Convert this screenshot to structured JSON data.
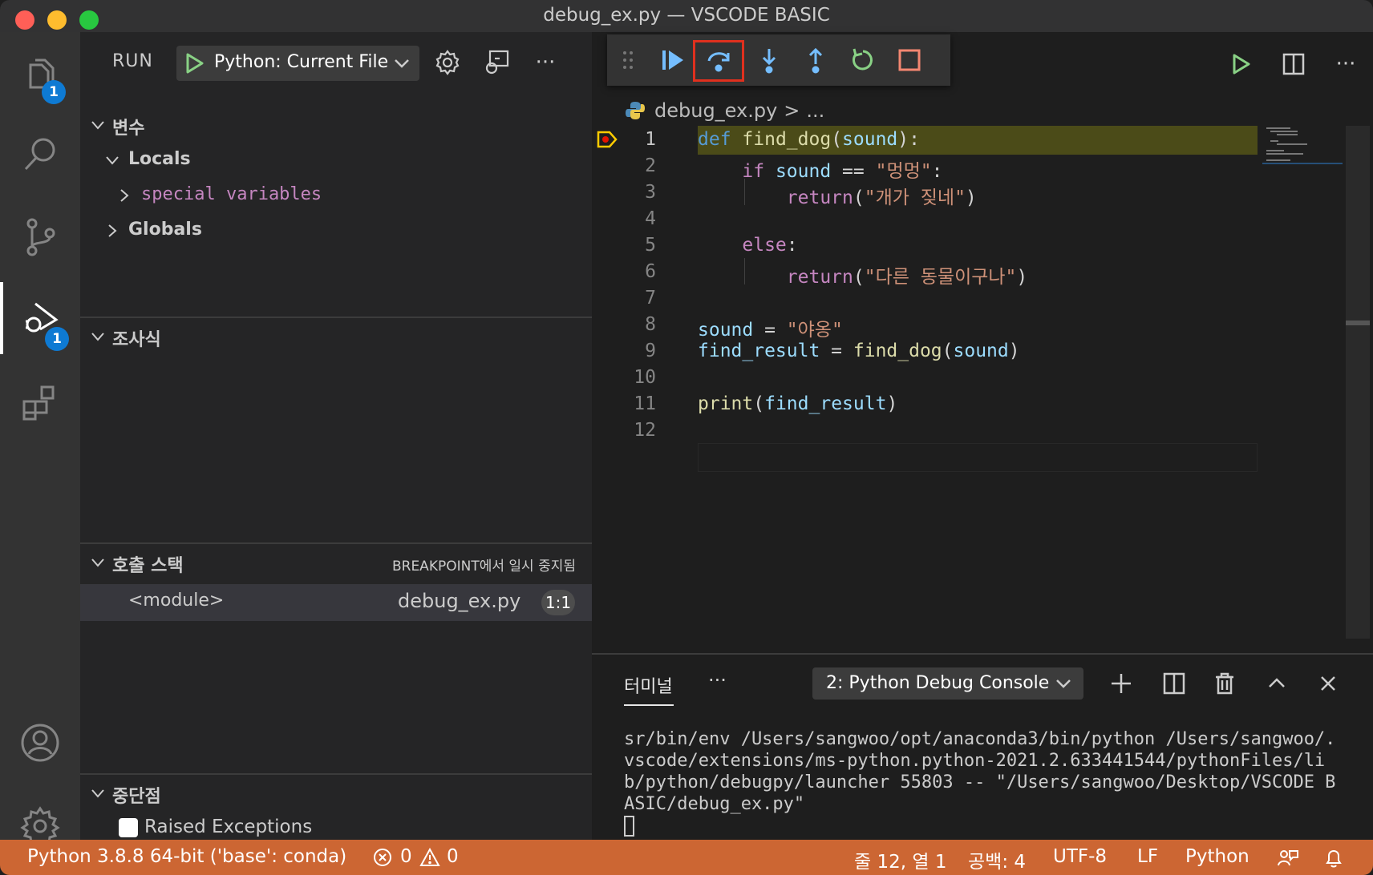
{
  "window": {
    "title": "debug_ex.py — VSCODE BASIC"
  },
  "activity_bar": {
    "explorer_badge": "1",
    "debug_badge": "1"
  },
  "sidebar": {
    "run_label": "RUN",
    "config_name": "Python: Current File",
    "sections": {
      "variables": "변수",
      "locals": "Locals",
      "special_variables": "special variables",
      "globals": "Globals",
      "watch": "조사식",
      "call_stack": "호출 스택",
      "call_stack_status": "BREAKPOINT에서 일시 중지됨",
      "breakpoints": "중단점"
    },
    "call_stack_frames": [
      {
        "name": "<module>",
        "file": "debug_ex.py",
        "position": "1:1"
      }
    ],
    "breakpoint_items": [
      {
        "label": "Raised Exceptions",
        "checked": false
      }
    ]
  },
  "editor": {
    "breadcrumb_file": "debug_ex.py",
    "breadcrumb_sep": ">",
    "breadcrumb_more": "...",
    "current_line": 1,
    "lines": [
      {
        "n": "1",
        "text": "def find_dog(sound):"
      },
      {
        "n": "2",
        "text": "    if sound == \"멍멍\":"
      },
      {
        "n": "3",
        "text": "        return(\"개가 짖네\")"
      },
      {
        "n": "4",
        "text": ""
      },
      {
        "n": "5",
        "text": "    else:"
      },
      {
        "n": "6",
        "text": "        return(\"다른 동물이구나\")"
      },
      {
        "n": "7",
        "text": ""
      },
      {
        "n": "8",
        "text": "sound = \"야옹\""
      },
      {
        "n": "9",
        "text": "find_result = find_dog(sound)"
      },
      {
        "n": "10",
        "text": ""
      },
      {
        "n": "11",
        "text": "print(find_result)"
      },
      {
        "n": "12",
        "text": ""
      }
    ]
  },
  "panel": {
    "tab": "터미널",
    "more": "···",
    "terminal_select": "2: Python Debug Console",
    "output": "sr/bin/env /Users/sangwoo/opt/anaconda3/bin/python /Users/sangwoo/.vscode/extensions/ms-python.python-2021.2.633441544/pythonFiles/lib/python/debugpy/launcher 55803 -- \"/Users/sangwoo/Desktop/VSCODE BASIC/debug_ex.py\""
  },
  "statusbar": {
    "interpreter": "Python 3.8.8 64-bit ('base': conda)",
    "errors": "0",
    "warnings": "0",
    "cursor_position": "줄 12, 열 1",
    "indent": "공백: 4",
    "encoding": "UTF-8",
    "eol": "LF",
    "language": "Python"
  },
  "colors": {
    "statusbar": "#cc6633",
    "accent_blue": "#0e7ad3",
    "highlight_red": "#e0301e",
    "current_line": "#4b4b18",
    "keyword": "#569cd6",
    "control": "#c586c0",
    "string": "#ce9178",
    "function": "#dcdcaa",
    "variable": "#9cdcfe",
    "debug_green": "#89d185"
  },
  "icons": [
    "files-icon",
    "search-icon",
    "source-control-icon",
    "run-debug-icon",
    "extensions-icon",
    "account-icon",
    "settings-gear-icon",
    "drag-handle-icon",
    "continue-icon",
    "step-over-icon",
    "step-into-icon",
    "step-out-icon",
    "restart-icon",
    "stop-icon",
    "run-icon",
    "split-editor-icon",
    "more-icon",
    "python-file-icon",
    "breakpoint-current-icon",
    "add-terminal-icon",
    "split-terminal-icon",
    "trash-icon",
    "maximize-panel-icon",
    "close-panel-icon",
    "error-icon",
    "warning-icon",
    "feedback-icon",
    "bell-icon"
  ]
}
